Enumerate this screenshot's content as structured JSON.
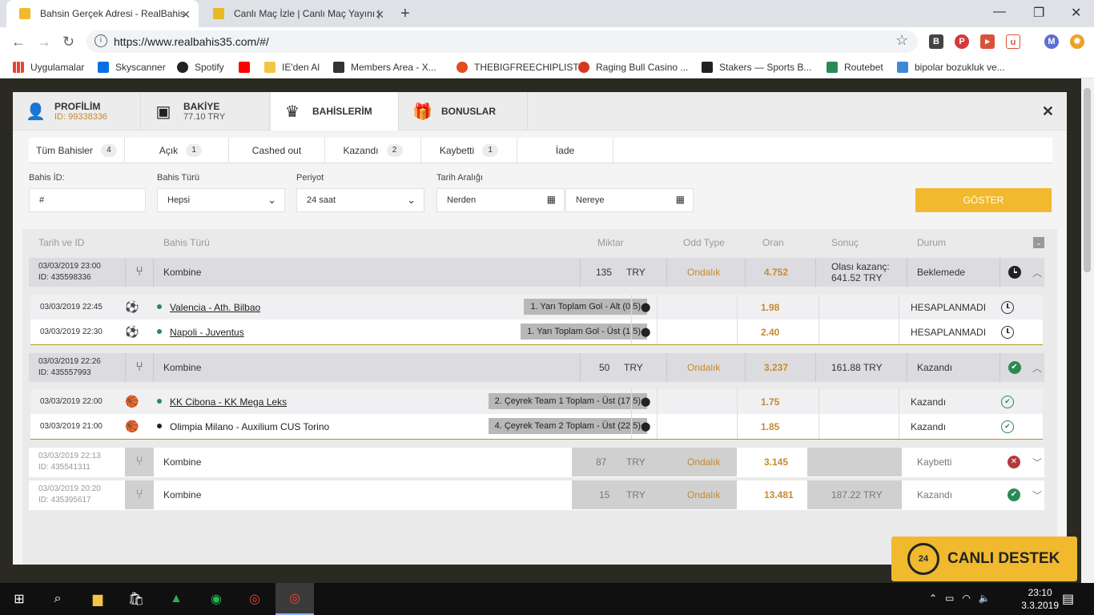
{
  "browser": {
    "tabs": [
      {
        "title": "Bahsin Gerçek Adresi - RealBahis",
        "active": true
      },
      {
        "title": "Canlı Maç İzle | Canlı Maç Yayını |",
        "active": false
      }
    ],
    "url": "https://www.realbahis35.com/#/",
    "bookmarks": [
      "Uygulamalar",
      "Skyscanner",
      "Spotify",
      "",
      "IE'den Al",
      "Members Area - X...",
      "THEBIGFREECHIPLIST",
      "Raging Bull Casino ...",
      "Stakers — Sports B...",
      "Routebet",
      "bipolar bozukluk ve..."
    ],
    "profile_letter": "M"
  },
  "modal": {
    "tabs": {
      "profile": {
        "title": "PROFİLİM",
        "sub": "ID: 99338336"
      },
      "balance": {
        "title": "BAKİYE",
        "sub": "77.10 TRY"
      },
      "bets": {
        "title": "BAHİSLERİM"
      },
      "bonus": {
        "title": "BONUSLAR"
      }
    },
    "close": "✕",
    "filters": [
      {
        "label": "Tüm Bahisler",
        "count": "4"
      },
      {
        "label": "Açık",
        "count": "1"
      },
      {
        "label": "Cashed out",
        "count": ""
      },
      {
        "label": "Kazandı",
        "count": "2"
      },
      {
        "label": "Kaybetti",
        "count": "1"
      },
      {
        "label": "İade",
        "count": ""
      }
    ],
    "form": {
      "bet_id_label": "Bahis İD:",
      "bet_id_value": "#",
      "bet_type_label": "Bahis Türü",
      "bet_type_value": "Hepsi",
      "period_label": "Periyot",
      "period_value": "24 saat",
      "date_label": "Tarih Aralığı",
      "from_placeholder": "Nerden",
      "to_placeholder": "Nereye",
      "show_button": "GÖSTER"
    },
    "headers": {
      "date_id": "Tarih ve ID",
      "type": "Bahis Türü",
      "amount": "Miktar",
      "odd_type": "Odd Type",
      "rate": "Oran",
      "result": "Sonuç",
      "status": "Durum"
    },
    "bets": [
      {
        "date": "03/03/2019 23:00",
        "id": "ID: 435598336",
        "type": "Kombine",
        "amount": "135",
        "currency": "TRY",
        "odd_type": "Ondalık",
        "rate": "4.752",
        "result_line1": "Olası kazanç:",
        "result_line2": "641.52 TRY",
        "status": "Beklemede",
        "selections": [
          {
            "date": "03/03/2019 22:45",
            "match": "Valencia - Ath. Bilbao",
            "market": "1. Yarı Toplam Gol - Alt (0.5)",
            "rate": "1.98",
            "status": "HESAPLANMADI"
          },
          {
            "date": "03/03/2019 22:30",
            "match": "Napoli - Juventus",
            "market": "1. Yarı Toplam Gol - Üst (1.5)",
            "rate": "2.40",
            "status": "HESAPLANMADI"
          }
        ]
      },
      {
        "date": "03/03/2019 22:26",
        "id": "ID: 435557993",
        "type": "Kombine",
        "amount": "50",
        "currency": "TRY",
        "odd_type": "Ondalık",
        "rate": "3.237",
        "result": "161.88 TRY",
        "status": "Kazandı",
        "selections": [
          {
            "date": "03/03/2019 22:00",
            "match": "KK Cibona - KK Mega Leks",
            "market": "2. Çeyrek Team 1 Toplam - Üst (17.5)",
            "rate": "1.75",
            "status": "Kazandı"
          },
          {
            "date": "03/03/2019 21:00",
            "match": "Olimpia Milano - Auxilium CUS Torino",
            "market": "4. Çeyrek Team 2 Toplam - Üst (22.5)",
            "rate": "1.85",
            "status": "Kazandı"
          }
        ]
      },
      {
        "date": "03/03/2019 22:13",
        "id": "ID: 435541311",
        "type": "Kombine",
        "amount": "87",
        "currency": "TRY",
        "odd_type": "Ondalık",
        "rate": "3.145",
        "result": "",
        "status": "Kaybetti"
      },
      {
        "date": "03/03/2019 20:20",
        "id": "ID: 435395617",
        "type": "Kombine",
        "amount": "15",
        "currency": "TRY",
        "odd_type": "Ondalık",
        "rate": "13.481",
        "result": "187.22 TRY",
        "status": "Kazandı"
      }
    ]
  },
  "live_support": "CANLI DESTEK",
  "live_support_badge": "24",
  "taskbar": {
    "time": "23:10",
    "date": "3.3.2019"
  },
  "colors": {
    "accent": "#f0b92e",
    "odd": "#c8892e",
    "win": "#2a8a55",
    "lose": "#b33a3a"
  }
}
